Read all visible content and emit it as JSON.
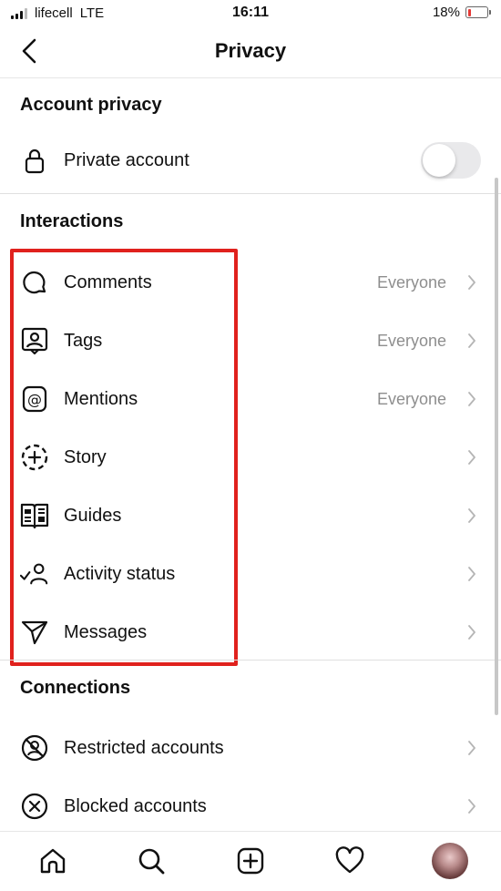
{
  "status_bar": {
    "carrier": "lifecell",
    "network": "LTE",
    "time": "16:11",
    "battery": "18%",
    "battery_level": 0.18
  },
  "nav": {
    "title": "Privacy",
    "back_icon": "chevron-left-icon"
  },
  "account_privacy": {
    "header": "Account privacy",
    "private_account": {
      "label": "Private account",
      "icon": "lock-icon",
      "enabled": false
    }
  },
  "interactions": {
    "header": "Interactions",
    "items": [
      {
        "label": "Comments",
        "value": "Everyone",
        "icon": "comment-bubble-icon"
      },
      {
        "label": "Tags",
        "value": "Everyone",
        "icon": "tag-person-icon"
      },
      {
        "label": "Mentions",
        "value": "Everyone",
        "icon": "at-sign-icon"
      },
      {
        "label": "Story",
        "value": "",
        "icon": "story-add-icon"
      },
      {
        "label": "Guides",
        "value": "",
        "icon": "guide-book-icon"
      },
      {
        "label": "Activity status",
        "value": "",
        "icon": "activity-status-icon"
      },
      {
        "label": "Messages",
        "value": "",
        "icon": "paper-plane-icon"
      }
    ]
  },
  "connections": {
    "header": "Connections",
    "items": [
      {
        "label": "Restricted accounts",
        "icon": "restricted-icon"
      },
      {
        "label": "Blocked accounts",
        "icon": "blocked-icon"
      }
    ]
  },
  "tab_bar": {
    "items": [
      {
        "name": "home",
        "icon": "home-icon"
      },
      {
        "name": "search",
        "icon": "search-icon"
      },
      {
        "name": "create",
        "icon": "add-square-icon"
      },
      {
        "name": "activity",
        "icon": "heart-icon"
      },
      {
        "name": "profile",
        "icon": "avatar"
      }
    ]
  },
  "colors": {
    "highlight": "#e0211d",
    "secondary_text": "#8e8e8e",
    "toggle_off": "#e9e9eb",
    "battery_low": "#e53935"
  }
}
